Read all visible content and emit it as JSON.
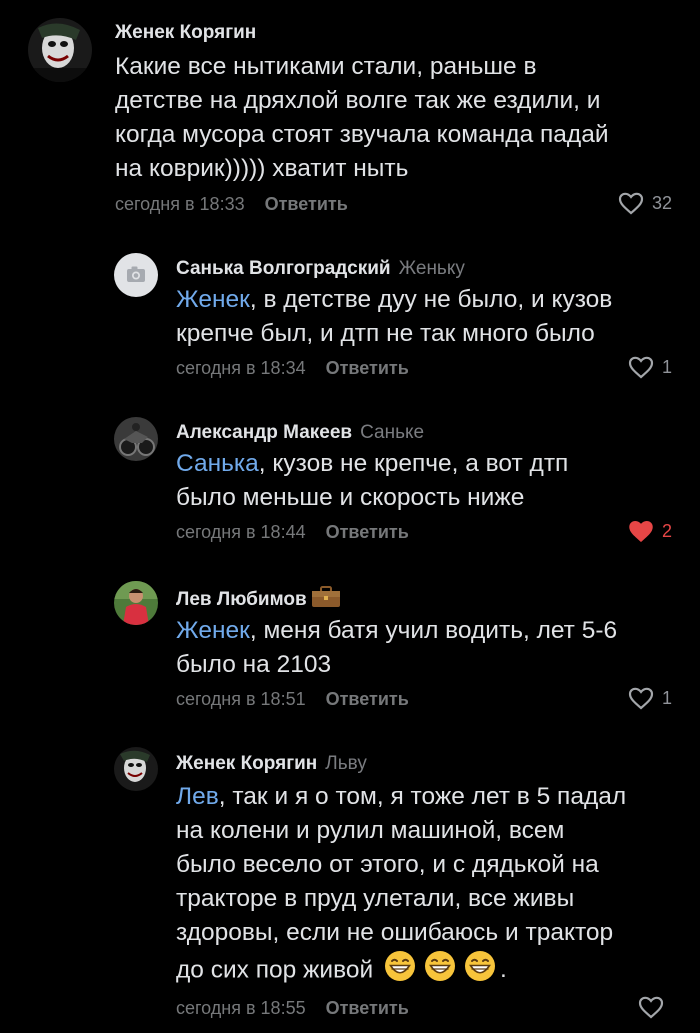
{
  "comments": [
    {
      "author": "Женек Корягин",
      "reply_to": "",
      "mention": "",
      "text_lines": [
        "Какие все нытиками стали, раньше в",
        "детстве на дряхлой волге так же ездили, и",
        "когда мусора стоят звучала команда падай",
        "на коврик))))) хватит ныть"
      ],
      "time": "сегодня в 18:33",
      "reply_label": "Ответить",
      "likes": "32",
      "liked": false
    },
    {
      "author": "Санька Волгоградский",
      "reply_to": "Женьку",
      "mention": "Женек",
      "text_lines": [
        ", в детстве дуу не было, и кузов",
        "крепче был, и дтп не так много было"
      ],
      "time": "сегодня в 18:34",
      "reply_label": "Ответить",
      "likes": "1",
      "liked": false
    },
    {
      "author": "Александр Макеев",
      "reply_to": "Саньке",
      "mention": "Санька",
      "text_lines": [
        ", кузов не крепче, а вот дтп",
        "было меньше и скорость ниже"
      ],
      "time": "сегодня в 18:44",
      "reply_label": "Ответить",
      "likes": "2",
      "liked": true
    },
    {
      "author": "Лев Любимов",
      "reply_to": "",
      "mention": "Женек",
      "text_lines": [
        ", меня батя учил водить, лет 5-6",
        "было на 2103"
      ],
      "time": "сегодня в 18:51",
      "reply_label": "Ответить",
      "likes": "1",
      "liked": false
    },
    {
      "author": "Женек Корягин",
      "reply_to": "Льву",
      "mention": "Лев",
      "text_lines": [
        ", так и я о том, я тоже лет в 5 падал",
        "на колени и рулил машиной, всем",
        "было весело от этого, и с дядькой на",
        "тракторе в пруд улетали, все живы",
        "здоровы, если не ошибаюсь и трактор",
        "до сих пор живой"
      ],
      "text_end": ".",
      "time": "сегодня в 18:55",
      "reply_label": "Ответить",
      "likes": "",
      "liked": false
    }
  ],
  "icons": {
    "like": "heart-outline-icon",
    "liked": "heart-filled-icon",
    "badge": "briefcase-icon",
    "emoji": "grinning-face-emoji",
    "no_photo": "camera-icon"
  },
  "colors": {
    "background": "#000000",
    "text": "#e1e3e6",
    "muted": "#76787a",
    "mention": "#71aaeb",
    "liked_heart": "#e64646"
  }
}
